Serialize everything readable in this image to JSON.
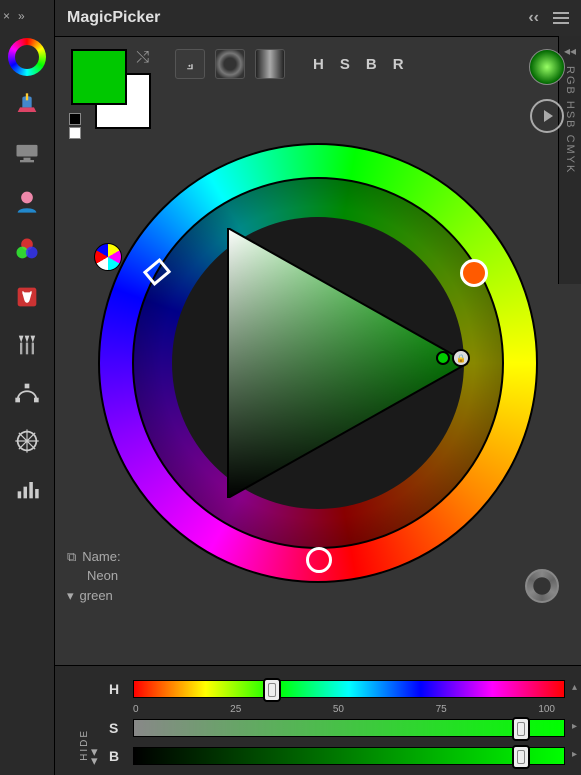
{
  "header": {
    "title": "MagicPicker",
    "close": "×",
    "collapse": "»",
    "back": "‹‹"
  },
  "toolbar": {
    "items": [
      {
        "name": "magic-hat-icon"
      },
      {
        "name": "screen-icon"
      },
      {
        "name": "portrait-icon"
      },
      {
        "name": "rgb-circles-icon"
      },
      {
        "name": "script-icon"
      },
      {
        "name": "brushes-icon"
      },
      {
        "name": "bezier-icon"
      },
      {
        "name": "wheel-compass-icon"
      },
      {
        "name": "bars-icon"
      }
    ]
  },
  "swatch": {
    "foreground": "#00c800",
    "background": "#ffffff"
  },
  "modes": {
    "letters": [
      "H",
      "S",
      "B",
      "R"
    ]
  },
  "side_tabs": "RGB HSB CMYK",
  "name_block": {
    "label": "Name:",
    "value1": "Neon",
    "value2": "green"
  },
  "sliders": {
    "ticks": [
      "0",
      "25",
      "50",
      "75",
      "100"
    ],
    "h": {
      "label": "H",
      "pos": 30
    },
    "s": {
      "label": "S",
      "pos": 88
    },
    "b": {
      "label": "B",
      "pos": 88
    },
    "hide": "HIDE"
  },
  "chart_data": {
    "type": "other",
    "description": "HSB color wheel with saturation-brightness triangle",
    "hue_deg": 120,
    "complement_deg": 15,
    "triangle_vertex_color": "#00c800",
    "sliders": {
      "H": 30,
      "S": 88,
      "B": 88
    }
  }
}
